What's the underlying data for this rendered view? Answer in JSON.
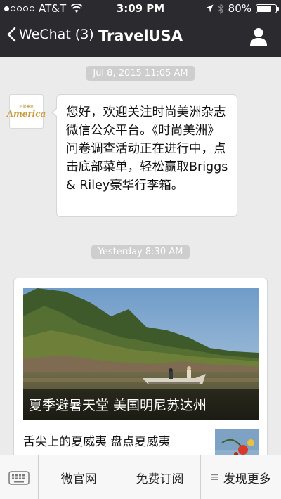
{
  "status_bar": {
    "signal_dots_filled": 1,
    "signal_dots_total": 5,
    "carrier": "AT&T",
    "time": "3:09 PM",
    "battery_text": "80%",
    "battery_level": 0.8,
    "icons": [
      "wifi-icon",
      "location-arrow-icon",
      "bluetooth-icon",
      "battery-icon"
    ]
  },
  "nav": {
    "back_label": "WeChat (3)",
    "title": "TravelUSA",
    "profile_icon": "person-icon"
  },
  "chat": {
    "avatar_small_text": "时尚美洲",
    "avatar_logo_text": "America",
    "timestamp_1": "Jul 8, 2015 11:05 AM",
    "message_1": "您好，欢迎关注时尚美洲杂志微信公众平台。《时尚美洲》问卷调查活动正在进行中，点击底部菜单，轻松赢取Briggs & Riley豪华行李箱。",
    "timestamp_2": "Yesterday 8:30 AM",
    "article": {
      "caption": "夏季避暑天堂 美国明尼苏达州",
      "sub_title": "舌尖上的夏威夷 盘点夏威夷"
    }
  },
  "bottom_menu": {
    "keyboard_icon": "keyboard-icon",
    "items": [
      {
        "label": "微官网"
      },
      {
        "label": "免费订阅"
      },
      {
        "label": "发现更多",
        "icon": "menu-lines-icon"
      }
    ]
  },
  "colors": {
    "bar_background": "#2b2b2f",
    "chat_background": "#ebebeb",
    "timestamp_pill": "#cecece"
  }
}
